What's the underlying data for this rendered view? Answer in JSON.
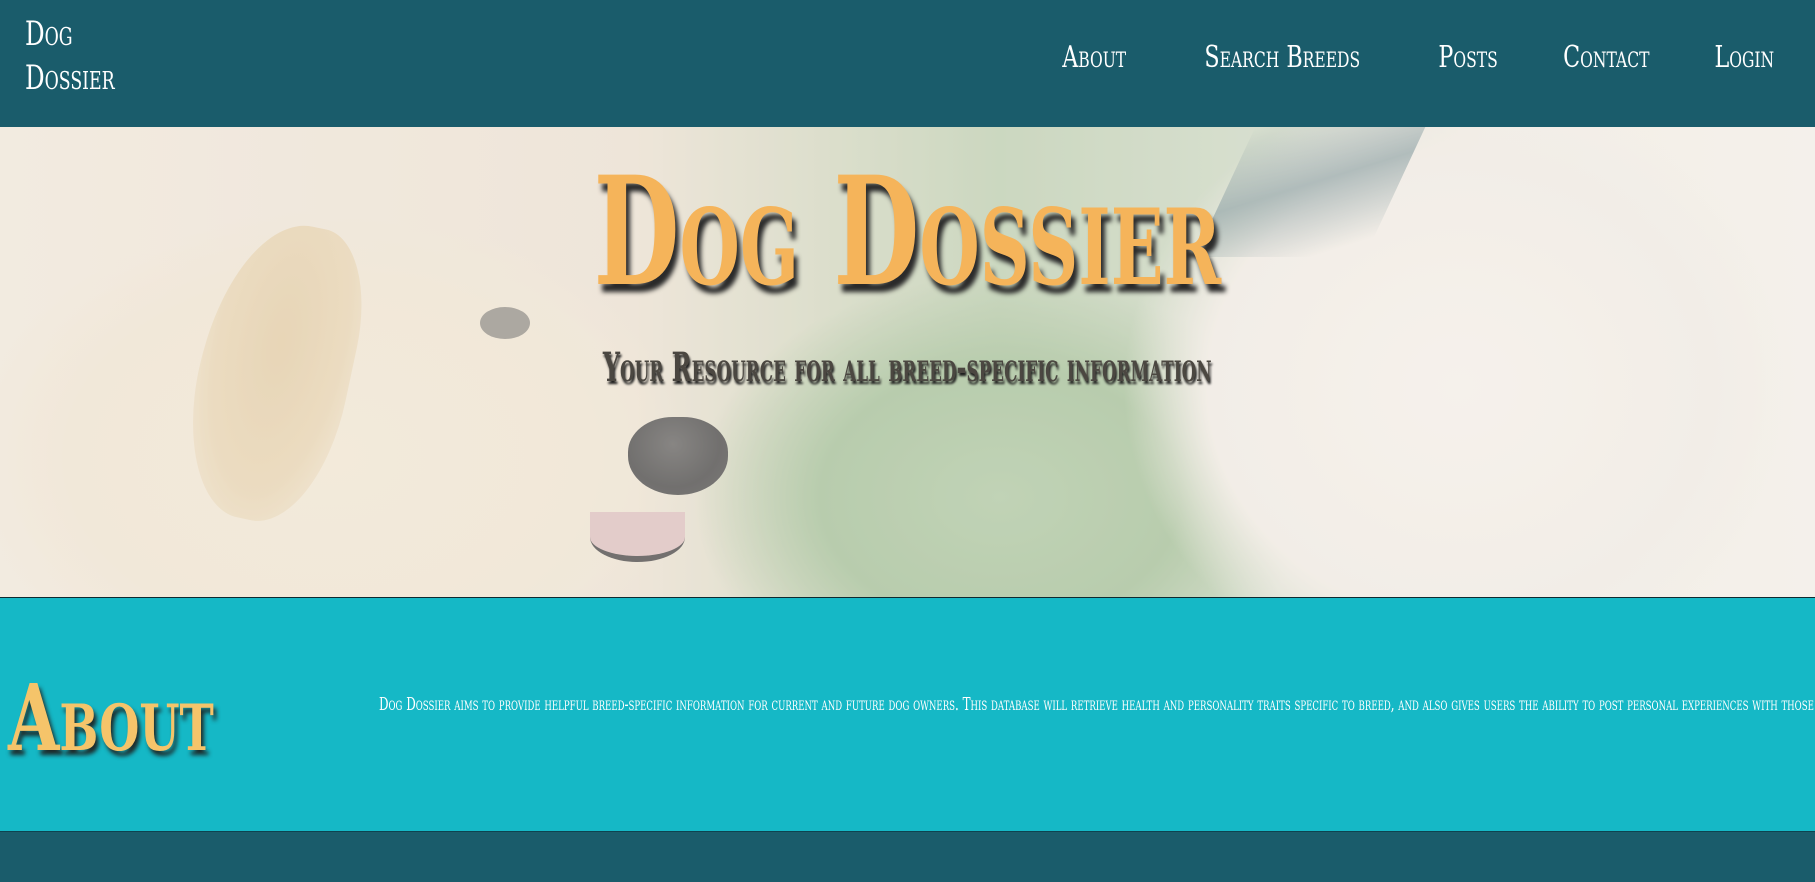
{
  "nav": {
    "brand": "Dog\nDossier",
    "links": [
      "About",
      "Search Breeds",
      "Posts",
      "Contact",
      "Login"
    ]
  },
  "hero": {
    "title": "Dog Dossier",
    "subtitle": "Your Resource for all breed-specific information"
  },
  "about": {
    "heading": "About",
    "text": "Dog Dossier aims to provide helpful breed-specific information for current and future dog owners. This database will retrieve health and personality traits specific to breed, and also gives users the ability to post personal experiences with those health or trait conce"
  },
  "colors": {
    "navbar": "#1a5c6b",
    "about_bg": "#15b8c6",
    "accent_orange": "#f5b45a"
  }
}
